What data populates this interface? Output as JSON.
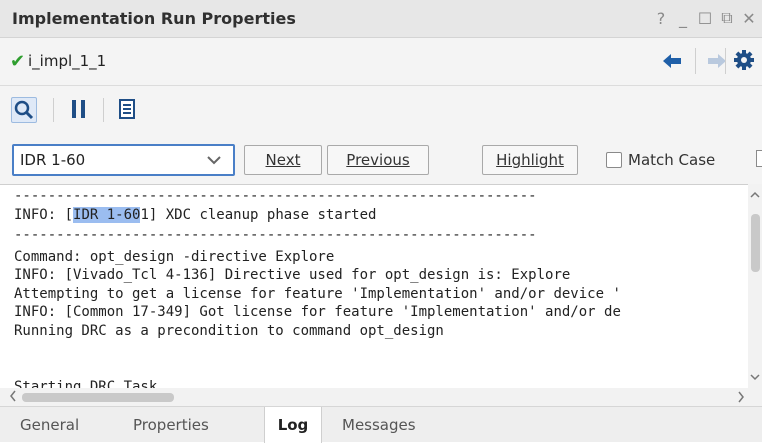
{
  "window": {
    "title": "Implementation Run Properties",
    "controls": {
      "help": "?",
      "minimize": "_",
      "maximize": "☐",
      "restore": "⧉",
      "close": "✕"
    }
  },
  "run": {
    "status_icon": "check-icon",
    "name": "i_impl_1_1"
  },
  "find": {
    "value": "IDR 1-60",
    "next_label": "Next",
    "previous_label": "Previous",
    "highlight_label": "Highlight",
    "match_case_label": "Match Case"
  },
  "log": {
    "lines": [
      {
        "text": "--------------------------------------------------------------"
      },
      {
        "before": "INFO: [",
        "highlight": "IDR 1-60",
        "after": "1] XDC cleanup phase started"
      },
      {
        "text": "--------------------------------------------------------------"
      },
      {
        "text": ""
      },
      {
        "text": "Command: opt_design -directive Explore"
      },
      {
        "text": "INFO: [Vivado_Tcl 4-136] Directive used for opt_design is: Explore"
      },
      {
        "text": "Attempting to get a license for feature 'Implementation' and/or device '"
      },
      {
        "text": "INFO: [Common 17-349] Got license for feature 'Implementation' and/or de"
      },
      {
        "text": "Running DRC as a precondition to command opt_design"
      },
      {
        "text": ""
      },
      {
        "text": "Starting DRC Task"
      }
    ]
  },
  "tabs": [
    "General",
    "Properties",
    "Log",
    "Messages"
  ],
  "active_tab": "Log",
  "colors": {
    "accent": "#4a7fc7",
    "highlight": "#9bbdf0",
    "success": "#2f9e2f"
  }
}
